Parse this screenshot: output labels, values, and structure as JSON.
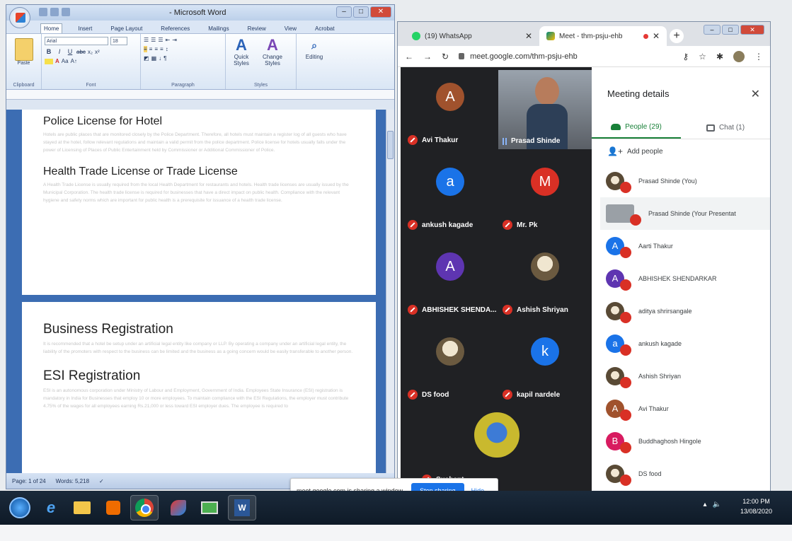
{
  "word": {
    "title": "- Microsoft Word",
    "tabs": [
      "Home",
      "Insert",
      "Page Layout",
      "References",
      "Mailings",
      "Review",
      "View",
      "Acrobat"
    ],
    "ribbon": {
      "paste": "Paste",
      "clipboard": "Clipboard",
      "font_name": "Arial",
      "font_size": "18",
      "font_group": "Font",
      "paragraph_group": "Paragraph",
      "quick_styles": "Quick Styles",
      "change_styles": "Change Styles",
      "styles_group": "Styles",
      "editing": "Editing"
    },
    "page1": {
      "h1": "Police License for Hotel",
      "p1": "Hotels are public places that are monitored closely by the Police Department. Therefore, all hotels must maintain a register log of all guests who have stayed at the hotel, follow relevant regulations and maintain a valid permit from the police department. Police license for hotels usually falls under the power of Licensing of Places of Public Entertainment held by Commissioner or Additional Commissioner of Police.",
      "h2": "Health Trade License or Trade License",
      "p2": "A Health Trade License is usually required from the local Health Department for restaurants and hotels. Health trade licenses are usually issued by the Municipal Corporation. The health trade license is required for businesses that have a direct impact on public health. Compliance with the relevant hygiene and safety norms which are important for public health is a prerequisite for issuance of a health trade license."
    },
    "page2": {
      "h1": "Business Registration",
      "p1": "It is recommended that a hotel be setup under an artificial legal entity like company or LLP. By operating a company under an artificial legal entity, the liability of the promoters with respect to the business can be limited and the business as a going concern would be easily transferable to another person.",
      "h2": "ESI Registration",
      "p2": "ESI is an autonomous corporation under Ministry of Labour and Employment, Government of India. Employees State Insurance (ESI) registration is mandatory in India for Businesses that employ 10 or more employees. To maintain compliance with the ESI Regulations, the employer must contribute 4.75% of the wages for all employees earning Rs.21,000 or less toward ESI employer dues. The employee is required to"
    },
    "status": {
      "page": "Page: 1 of 24",
      "words": "Words: 5,218"
    }
  },
  "chrome": {
    "tab_whatsapp": "(19) WhatsApp",
    "tab_meet": "Meet - thm-psju-ehb",
    "url": "meet.google.com/thm-psju-ehb"
  },
  "meet": {
    "tiles": [
      {
        "initial": "A",
        "name": "Avi Thakur",
        "color": "#a0522d"
      },
      {
        "initial": "a",
        "name": "ankush kagade",
        "color": "#1a73e8"
      },
      {
        "initial": "M",
        "name": "Mr. Pk",
        "color": "#d93025"
      },
      {
        "initial": "A",
        "name": "ABHISHEK SHENDA...",
        "color": "#5e35b1"
      },
      {
        "initial": "",
        "name": "Ashish Shriyan",
        "color": ""
      },
      {
        "initial": "",
        "name": "DS food",
        "color": ""
      },
      {
        "initial": "k",
        "name": "kapil nardele",
        "color": "#1a73e8"
      },
      {
        "initial": "",
        "name": "Sushant...",
        "color": ""
      }
    ],
    "video_name": "Prasad Shinde",
    "details": {
      "title": "Meeting details",
      "people_tab": "People (29)",
      "chat_tab": "Chat (1)",
      "add_people": "Add people",
      "people": [
        {
          "initial": "",
          "name": "Prasad Shinde (You)",
          "color": ""
        },
        {
          "initial": "",
          "name": "Prasad Shinde (Your Presentat",
          "color": "#9aa0a6"
        },
        {
          "initial": "A",
          "name": "Aarti Thakur",
          "color": "#1a73e8"
        },
        {
          "initial": "A",
          "name": "ABHISHEK SHENDARKAR",
          "color": "#5e35b1"
        },
        {
          "initial": "",
          "name": "aditya shrirsangale",
          "color": ""
        },
        {
          "initial": "a",
          "name": "ankush kagade",
          "color": "#1a73e8"
        },
        {
          "initial": "",
          "name": "Ashish Shriyan",
          "color": ""
        },
        {
          "initial": "A",
          "name": "Avi Thakur",
          "color": "#a0522d"
        },
        {
          "initial": "B",
          "name": "Buddhaghosh Hingole",
          "color": "#d81b60"
        },
        {
          "initial": "",
          "name": "DS food",
          "color": ""
        }
      ]
    },
    "share": {
      "text": "meet.google.com is sharing a window.",
      "stop": "Stop sharing",
      "hide": "Hide"
    }
  },
  "taskbar": {
    "time": "12:00 PM",
    "date": "13/08/2020"
  }
}
